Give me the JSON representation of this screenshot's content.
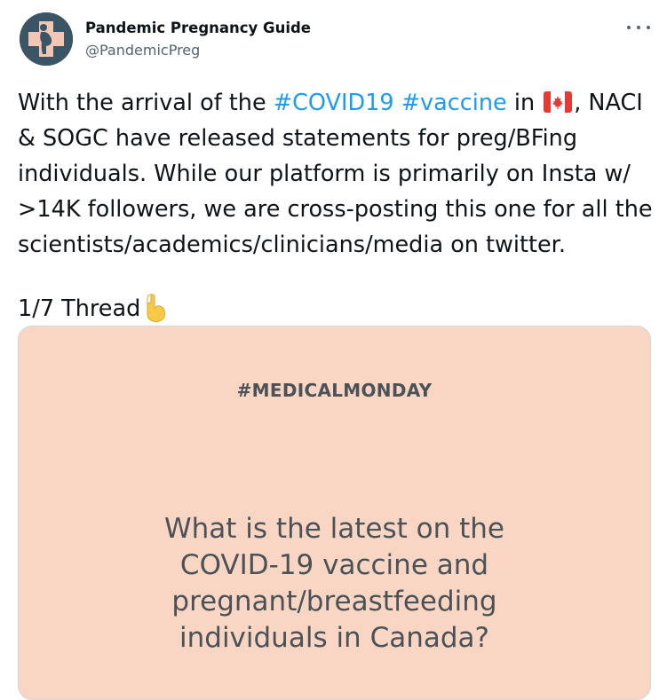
{
  "author": {
    "display_name": "Pandemic Pregnancy Guide",
    "handle": "@PandemicPreg",
    "avatar_icon": "pregnant-figure-cross-icon"
  },
  "more_icon": "more-options-icon",
  "tweet": {
    "line1_pre": "With the arrival of the ",
    "hashtag1": "#COVID19",
    "line1_space": " ",
    "hashtag2": "#vaccine",
    "line1_mid": " in ",
    "flag_icon": "canada-flag-icon",
    "line1_post": ", NACI",
    "line2": "& SOGC have released statements for preg/BFing",
    "line3": "individuals. While our platform is primarily on Insta w/",
    "line4": ">14K followers, we are cross-posting this one for all the",
    "line5": "scientists/academics/clinicians/media on twitter.",
    "thread_label": "1/7 Thread",
    "emoji_icon": "pointing-down-hand-icon"
  },
  "media": {
    "title": "#MEDICALMONDAY",
    "question_lines": [
      "What is the latest on the",
      "COVID-19 vaccine and",
      "pregnant/breastfeeding",
      "individuals in Canada?"
    ],
    "background": "#f9d6c4"
  },
  "colors": {
    "hashtag": "#1d9bf0",
    "text": "#0f1419",
    "secondary": "#536471",
    "avatar_bg": "#3a5566"
  }
}
